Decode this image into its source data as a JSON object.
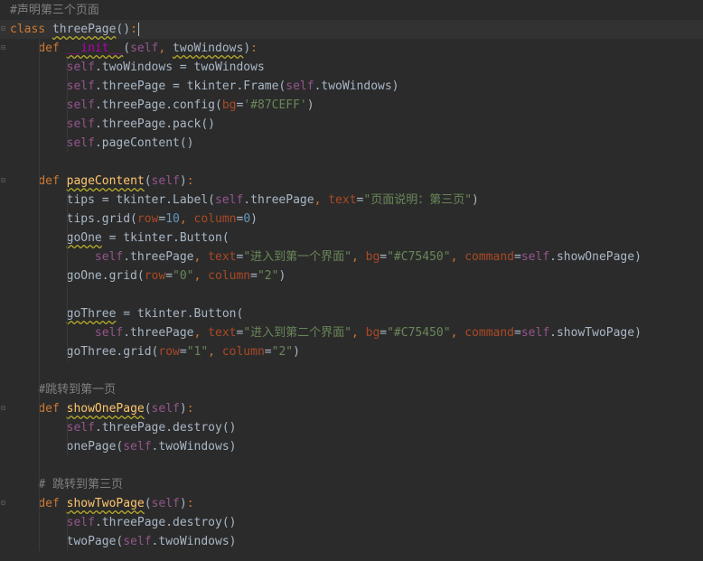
{
  "editor": {
    "lines": [
      "#声明第三个页面",
      "class threePage():",
      "    def __init__(self, twoWindows):",
      "        self.twoWindows = twoWindows",
      "        self.threePage = tkinter.Frame(self.twoWindows)",
      "        self.threePage.config(bg='#87CEFF')",
      "        self.threePage.pack()",
      "        self.pageContent()",
      "",
      "    def pageContent(self):",
      "        tips = tkinter.Label(self.threePage, text=\"页面说明：第三页\")",
      "        tips.grid(row=10, column=0)",
      "        goOne = tkinter.Button(",
      "            self.threePage, text=\"进入到第一个界面\", bg=\"#C75450\", command=self.showOnePage)",
      "        goOne.grid(row=\"0\", column=\"2\")",
      "",
      "        goThree = tkinter.Button(",
      "            self.threePage, text=\"进入到第二个界面\", bg=\"#C75450\", command=self.showTwoPage)",
      "        goThree.grid(row=\"1\", column=\"2\")",
      "",
      "    #跳转到第一页",
      "    def showOnePage(self):",
      "        self.threePage.destroy()",
      "        onePage(self.twoWindows)",
      "",
      "    # 跳转到第三页",
      "    def showTwoPage(self):",
      "        self.threePage.destroy()",
      "        twoPage(self.twoWindows)"
    ],
    "current_line": 2,
    "theme": {
      "background": "#2b2b2b",
      "keyword": "#cc7832",
      "self": "#94558d",
      "function": "#ffc66d",
      "string": "#6a8759",
      "number": "#6897bb",
      "param": "#aa4926",
      "comment": "#808080"
    }
  }
}
